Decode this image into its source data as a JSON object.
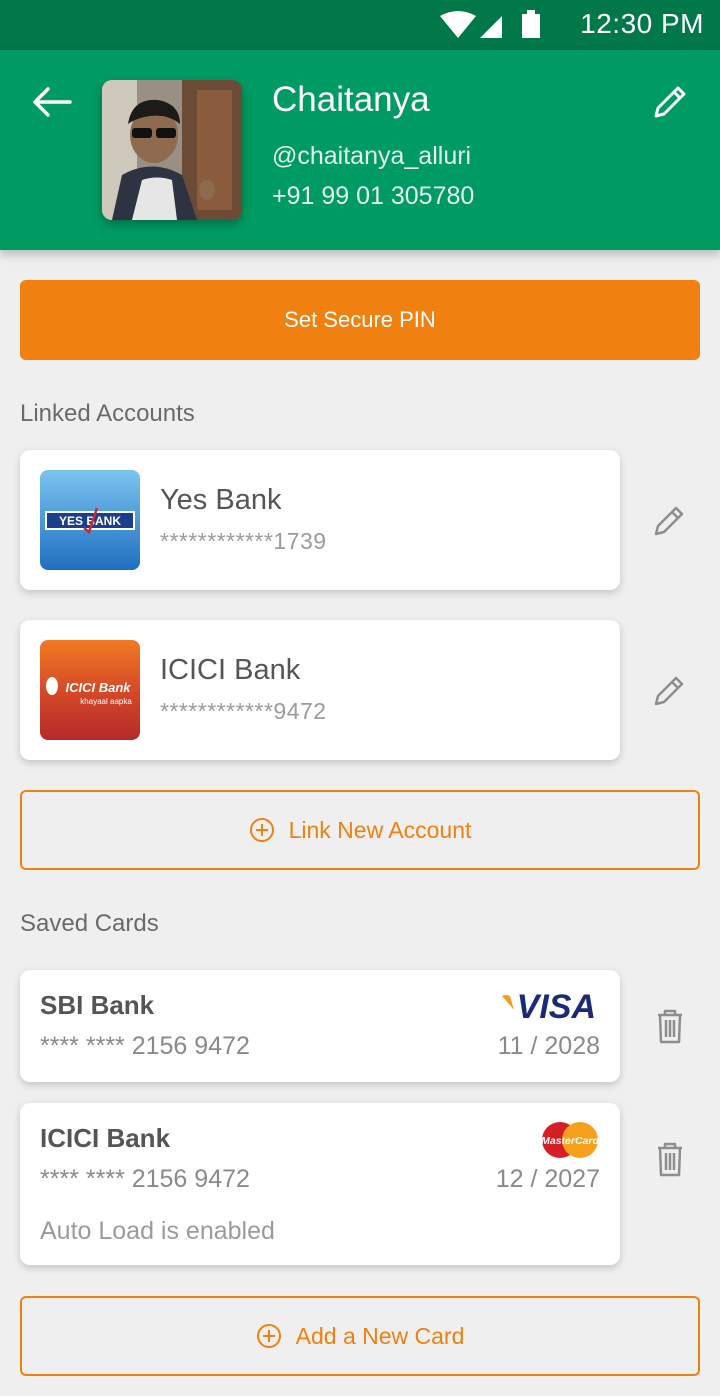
{
  "status_bar": {
    "time": "12:30 PM"
  },
  "profile": {
    "name": "Chaitanya",
    "handle": "@chaitanya_alluri",
    "phone": "+91 99 01 305780"
  },
  "actions": {
    "set_pin": "Set Secure PIN"
  },
  "linked_accounts": {
    "title": "Linked Accounts",
    "items": [
      {
        "bank": "Yes Bank",
        "number": "************1739",
        "logo_text": "YES BANK"
      },
      {
        "bank": "ICICI Bank",
        "number": "************9472",
        "logo_text": "ICICI Bank",
        "logo_tagline": "khayaal aapka"
      }
    ],
    "link_new": "Link New Account"
  },
  "saved_cards": {
    "title": "Saved Cards",
    "items": [
      {
        "bank": "SBI Bank",
        "number": "**** **** 2156 9472",
        "expiry": "11 / 2028",
        "brand": "VISA"
      },
      {
        "bank": "ICICI Bank",
        "number": "**** **** 2156 9472",
        "expiry": "12 / 2027",
        "brand": "MasterCard",
        "note": "Auto Load is enabled"
      }
    ],
    "add_new": "Add a New Card"
  },
  "colors": {
    "primary_green": "#009b62",
    "status_green": "#00784a",
    "accent_orange": "#f0800f"
  }
}
